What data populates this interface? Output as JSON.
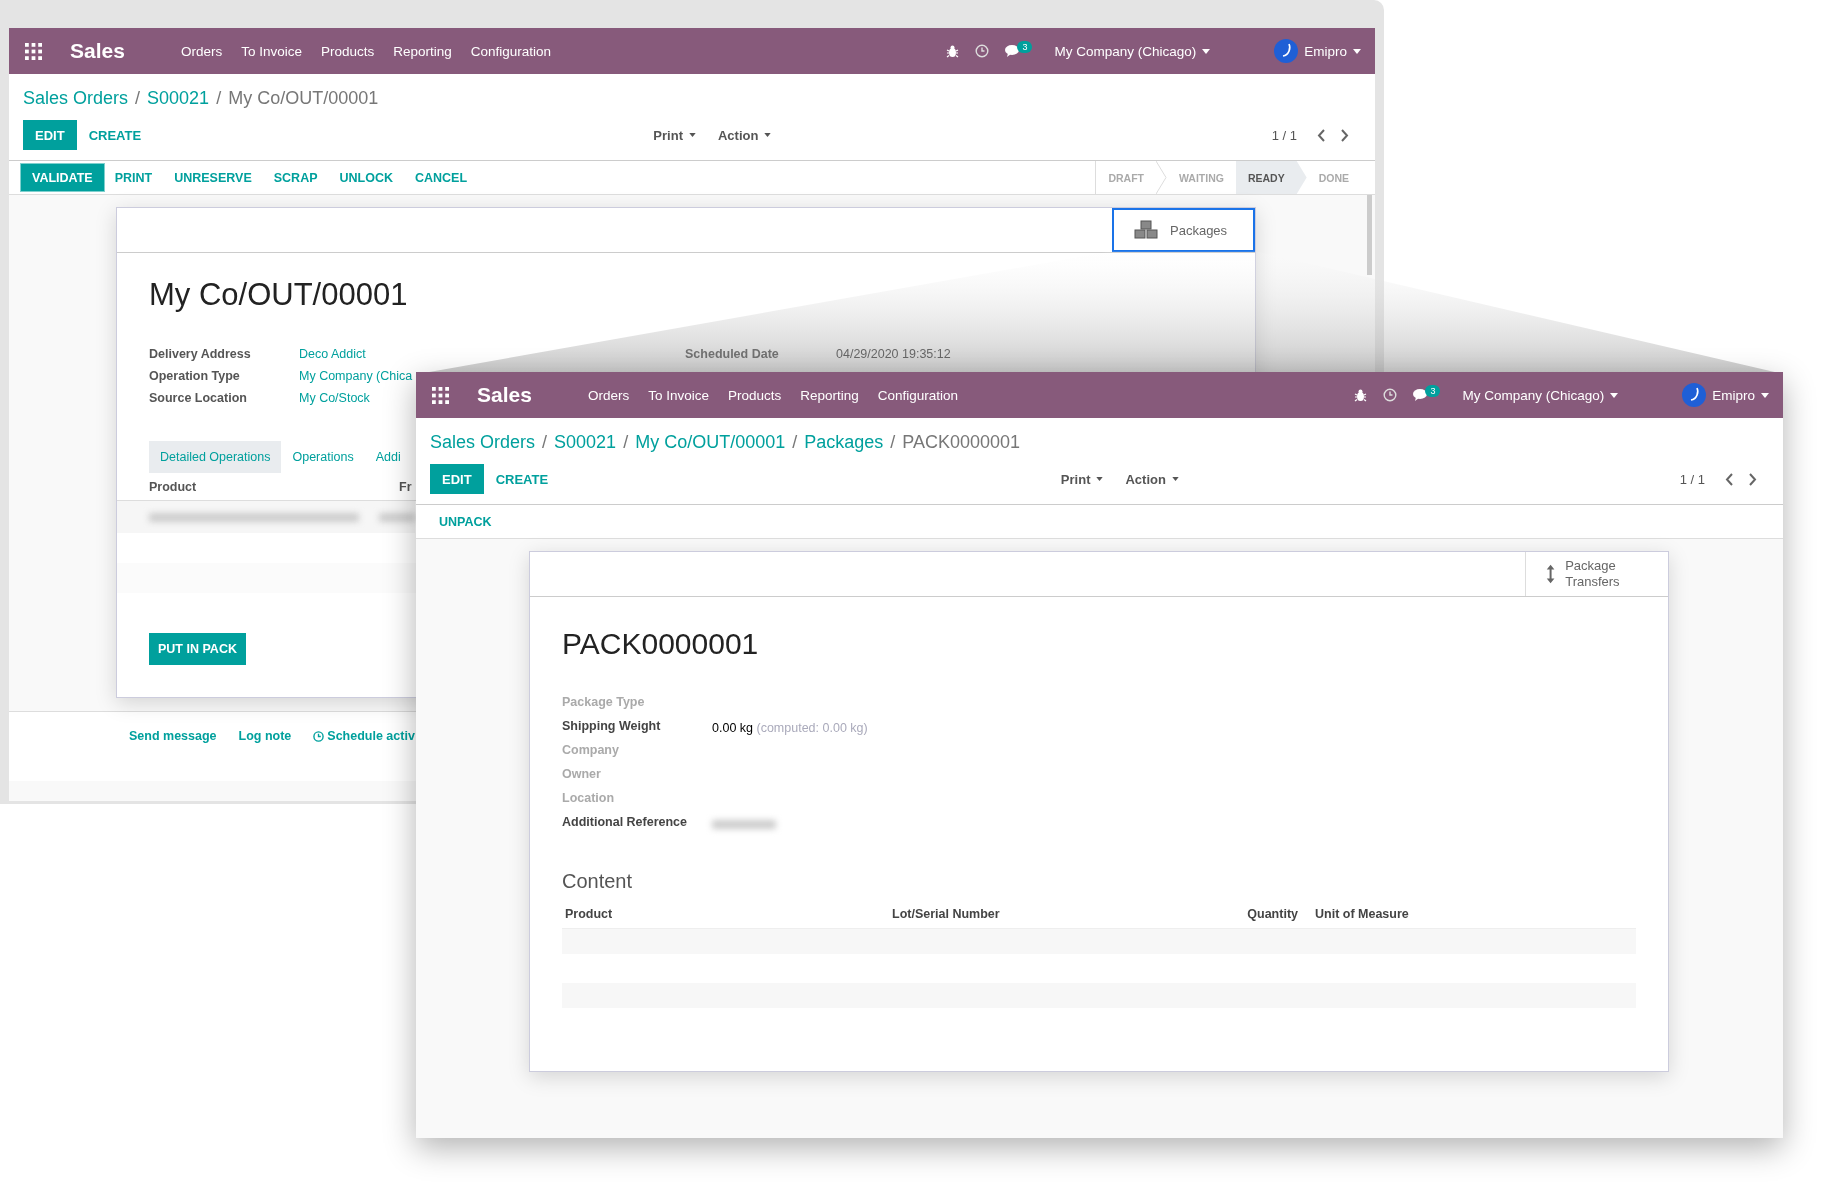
{
  "back_window": {
    "navbar": {
      "app_name": "Sales",
      "menu": [
        "Orders",
        "To Invoice",
        "Products",
        "Reporting",
        "Configuration"
      ],
      "message_count": "3",
      "company": "My Company (Chicago)",
      "user": "Emipro"
    },
    "breadcrumb": [
      {
        "label": "Sales Orders",
        "current": false
      },
      {
        "label": "S00021",
        "current": false
      },
      {
        "label": "My Co/OUT/00001",
        "current": true
      }
    ],
    "breadcrumb_separator": "/",
    "buttons": [
      {
        "label": "EDIT",
        "primary": true
      },
      {
        "label": "CREATE",
        "primary": false
      }
    ],
    "dropdowns": [
      "Print",
      "Action"
    ],
    "pager": "1 / 1",
    "actions": [
      {
        "label": "VALIDATE",
        "primary": true
      },
      {
        "label": "PRINT",
        "primary": false
      },
      {
        "label": "UNRESERVE",
        "primary": false
      },
      {
        "label": "SCRAP",
        "primary": false
      },
      {
        "label": "UNLOCK",
        "primary": false
      },
      {
        "label": "CANCEL",
        "primary": false
      }
    ],
    "status_steps": [
      {
        "label": "DRAFT",
        "selected": false
      },
      {
        "label": "WAITING",
        "selected": false
      },
      {
        "label": "READY",
        "selected": true
      },
      {
        "label": "DONE",
        "selected": false
      }
    ],
    "smart_button": {
      "label": "Packages",
      "highlighted": true
    },
    "title": "My Co/OUT/00001",
    "fields": [
      {
        "label": "Delivery Address",
        "value": "Deco Addict"
      },
      {
        "label": "Operation Type",
        "value": "My Company (Chica"
      },
      {
        "label": "Source Location",
        "value": "My Co/Stock"
      }
    ],
    "scheduled_date": {
      "label": "Scheduled Date",
      "value": "04/29/2020 19:35:12"
    },
    "tabs": [
      {
        "label": "Detailed Operations",
        "selected": true
      },
      {
        "label": "Operations",
        "selected": false
      },
      {
        "label": "Addi",
        "selected": false
      }
    ],
    "columns": [
      "Product",
      "Fr"
    ],
    "pack_button": "PUT IN PACK",
    "chatter": [
      {
        "label": "Send message",
        "kind": "plain"
      },
      {
        "label": "Log note",
        "kind": "plain"
      },
      {
        "label": "Schedule activ",
        "kind": "clock"
      }
    ]
  },
  "front_window": {
    "navbar": {
      "app_name": "Sales",
      "menu": [
        "Orders",
        "To Invoice",
        "Products",
        "Reporting",
        "Configuration"
      ],
      "message_count": "3",
      "company": "My Company (Chicago)",
      "user": "Emipro"
    },
    "breadcrumb": [
      {
        "label": "Sales Orders",
        "current": false
      },
      {
        "label": "S00021",
        "current": false
      },
      {
        "label": "My Co/OUT/00001",
        "current": false
      },
      {
        "label": "Packages",
        "current": false
      },
      {
        "label": "PACK0000001",
        "current": true
      }
    ],
    "breadcrumb_separator": "/",
    "buttons": [
      {
        "label": "EDIT",
        "primary": true
      },
      {
        "label": "CREATE",
        "primary": false
      }
    ],
    "dropdowns": [
      "Print",
      "Action"
    ],
    "pager": "1 / 1",
    "actions": [
      {
        "label": "UNPACK",
        "primary": false
      }
    ],
    "smart_button": {
      "label": "Package Transfers",
      "highlighted": false
    },
    "title": "PACK0000001",
    "fields": [
      {
        "label": "Package Type",
        "muted": true
      },
      {
        "label": "Shipping Weight",
        "muted": false,
        "value": "0.00 kg",
        "note": "(computed: 0.00 kg)"
      },
      {
        "label": "Company",
        "muted": true
      },
      {
        "label": "Owner",
        "muted": true
      },
      {
        "label": "Location",
        "muted": true
      },
      {
        "label": "Additional Reference",
        "muted": false,
        "redacted": true
      }
    ],
    "section_title": "Content",
    "columns": [
      "Product",
      "Lot/Serial Number",
      "Quantity",
      "Unit of Measure"
    ]
  }
}
